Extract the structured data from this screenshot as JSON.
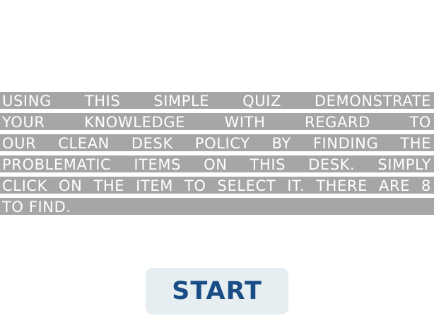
{
  "intro": {
    "lines": [
      "USING THIS SIMPLE QUIZ DEMONSTRATE",
      "YOUR KNOWLEDGE WITH REGARD TO",
      "OUR CLEAN DESK POLICY BY FINDING THE",
      "PROBLEMATIC ITEMS ON THIS DESK. SIMPLY",
      "CLICK ON THE ITEM TO SELECT IT. THERE ARE 8",
      "TO FIND."
    ]
  },
  "start_button": {
    "label": "START"
  },
  "colors": {
    "text_highlight": "#a6a6a6",
    "intro_text": "#ffffff",
    "button_bg": "#e6eef2",
    "button_text": "#1a4d86"
  }
}
